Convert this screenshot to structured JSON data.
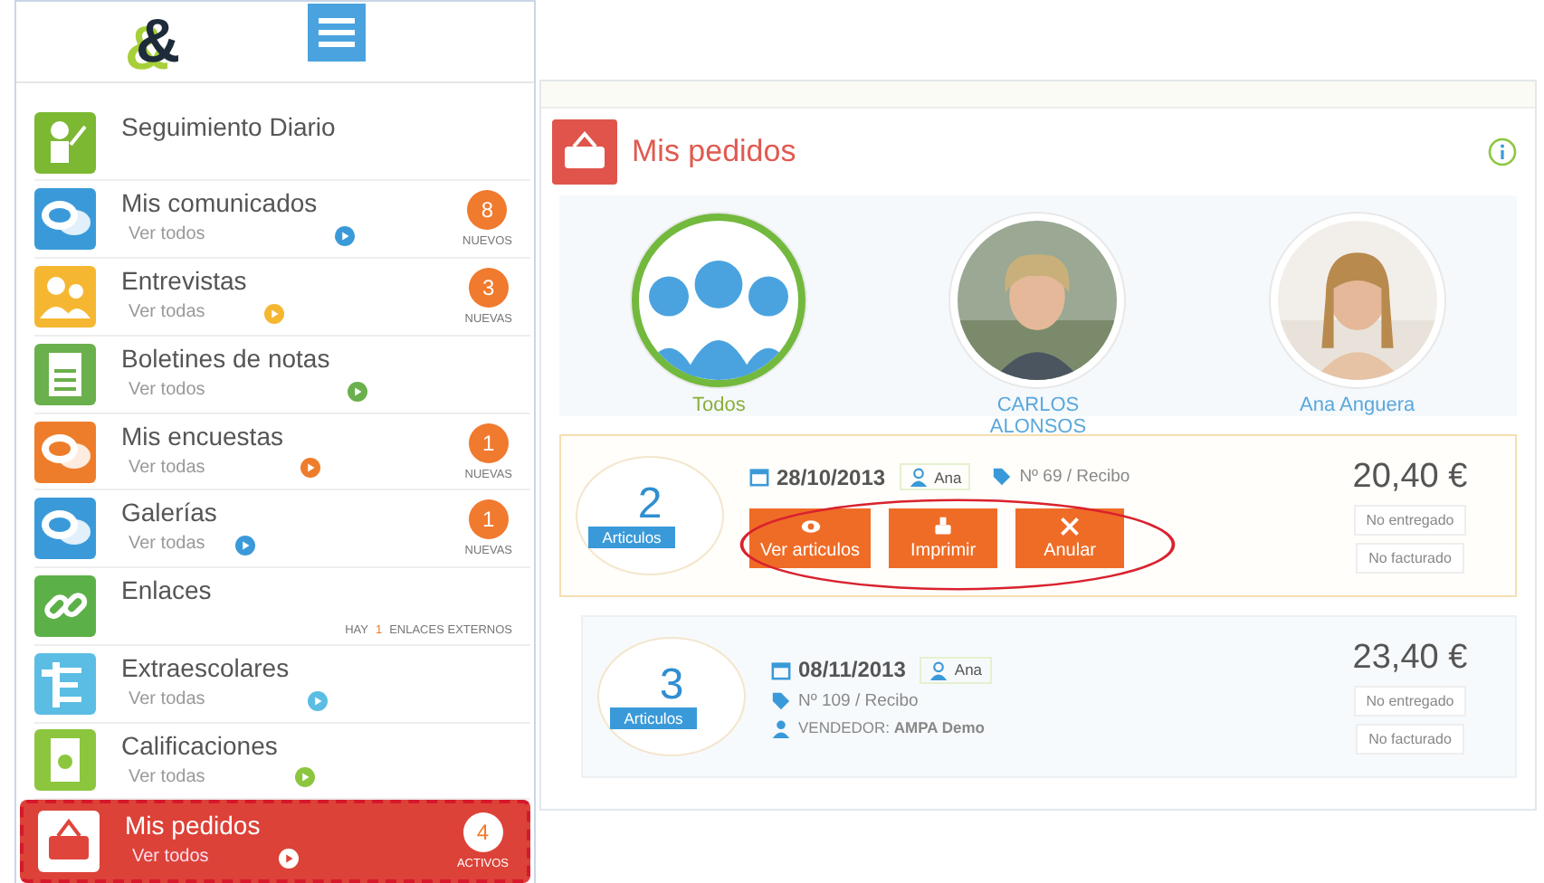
{
  "sidebar": {
    "logo": "&",
    "items": [
      {
        "title": "Seguimiento Diario",
        "kind": "teacher",
        "color": "#7cb832",
        "selected": false
      },
      {
        "title": "Mis comunicados",
        "kind": "chat",
        "color": "#3a9ad9",
        "link": "Ver todos",
        "badge": "8",
        "badge_label": "NUEVOS",
        "selected": false
      },
      {
        "title": "Entrevistas",
        "kind": "people",
        "color": "#f5b731",
        "link": "Ver todas",
        "badge": "3",
        "badge_label": "NUEVAS",
        "selected": false
      },
      {
        "title": "Boletines de notas",
        "kind": "sheet",
        "color": "#6ab04c",
        "link": "Ver todos",
        "selected": false
      },
      {
        "title": "Mis encuestas",
        "kind": "chat",
        "color": "#ee7d2b",
        "link": "Ver todas",
        "badge": "1",
        "badge_label": "NUEVAS",
        "selected": false
      },
      {
        "title": "Galerías",
        "kind": "chat",
        "color": "#3a9ad9",
        "link": "Ver todas",
        "badge": "1",
        "badge_label": "NUEVAS",
        "selected": false
      },
      {
        "title": "Enlaces",
        "kind": "link",
        "color": "#5cb048",
        "note": {
          "before": "HAY",
          "count": "1",
          "after": "ENLACES EXTERNOS"
        },
        "selected": false
      },
      {
        "title": "Extraescolares",
        "kind": "board",
        "color": "#5bbde4",
        "link": "Ver todas",
        "selected": false
      },
      {
        "title": "Calificaciones",
        "kind": "doc",
        "color": "#8cc63f",
        "link": "Ver todas",
        "selected": false
      },
      {
        "title": "Mis pedidos",
        "kind": "basket",
        "color": "#e0453c",
        "link": "Ver todos",
        "badge": "4",
        "badge_label": "ACTIVOS",
        "selected": true
      }
    ]
  },
  "panel": {
    "title": "Mis pedidos",
    "children": [
      {
        "name": "Todos",
        "kind": "group",
        "selected": true
      },
      {
        "name": "CARLOS ALONSOS",
        "kind": "picture",
        "selected": false
      },
      {
        "name": "Ana Anguera",
        "kind": "picture",
        "selected": false
      }
    ],
    "orders": [
      {
        "count": "2",
        "unit": "Articulos",
        "date": "28/10/2013",
        "person": "Ana",
        "ref": "Nº 69 / Recibo",
        "price": "20,40 €",
        "statuses": [
          "No entregado",
          "No facturado"
        ],
        "selected": true,
        "actions": [
          {
            "label": "Ver articulos",
            "kind": "eye"
          },
          {
            "label": "Imprimir",
            "kind": "printer"
          },
          {
            "label": "Anular",
            "kind": "close"
          }
        ]
      },
      {
        "count": "3",
        "unit": "Articulos",
        "date": "08/11/2013",
        "person": "Ana",
        "ref": "Nº 109 / Recibo",
        "seller": "VENDEDOR: **AMPA Demo**",
        "price": "23,40 €",
        "statuses": [
          "No entregado",
          "No facturado"
        ],
        "selected": false
      }
    ]
  }
}
